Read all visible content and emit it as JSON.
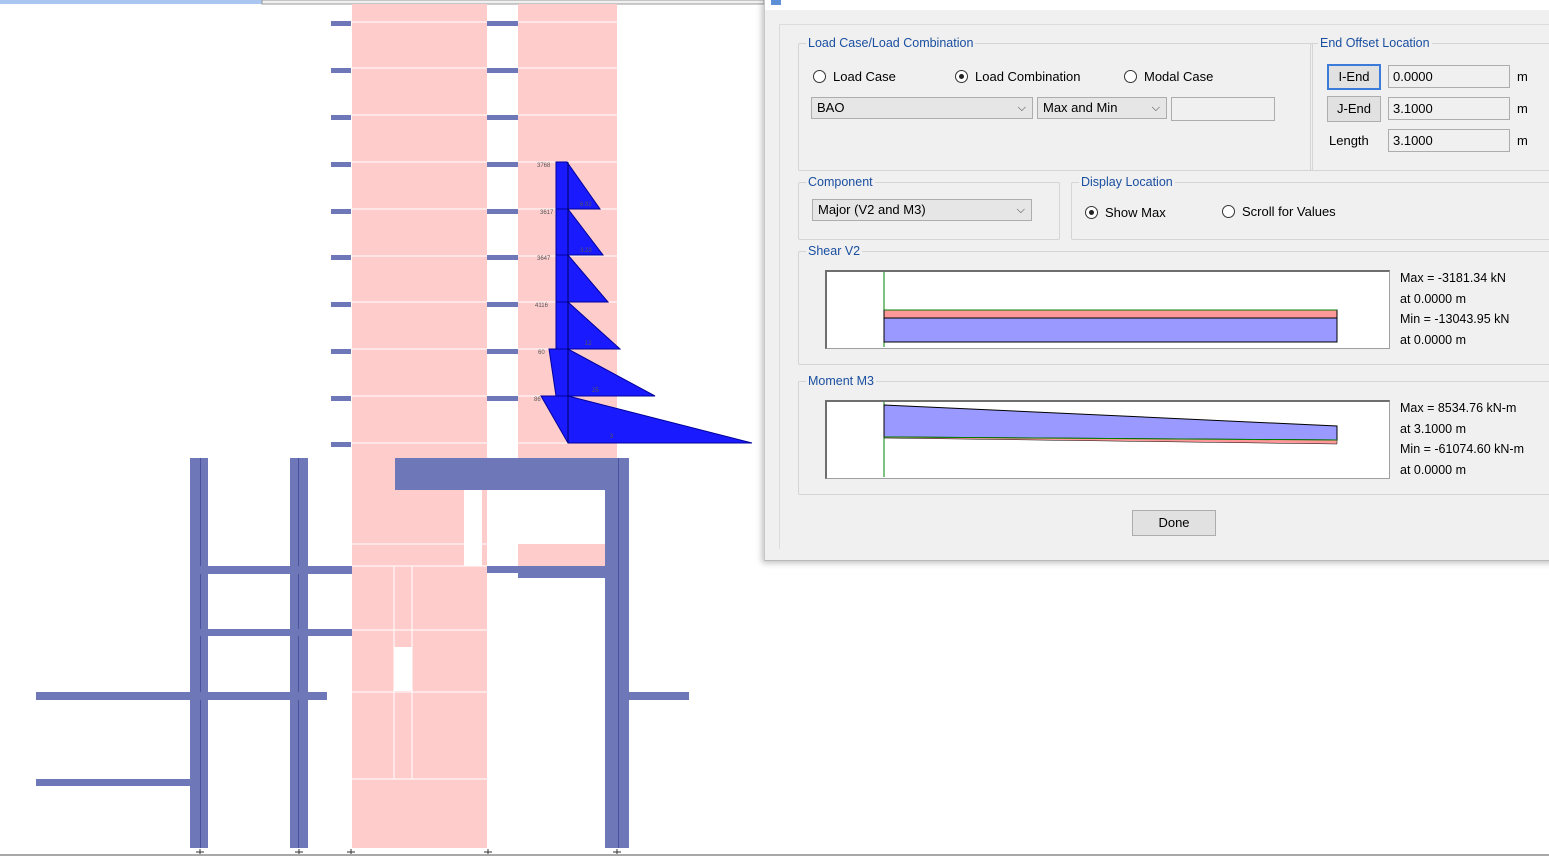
{
  "dialog": {
    "title": "",
    "load_case_group": {
      "legend": "Load Case/Load Combination",
      "options": [
        "Load Case",
        "Load Combination",
        "Modal Case"
      ],
      "selected_index": 1,
      "case_name": "BAO",
      "envelope": "Max and Min",
      "extra_field": ""
    },
    "end_offset": {
      "legend": "End Offset Location",
      "i_end_label": "I-End",
      "i_end_value": "0.0000",
      "j_end_label": "J-End",
      "j_end_value": "3.1000",
      "length_label": "Length",
      "length_value": "3.1000",
      "unit": "m"
    },
    "component": {
      "legend": "Component",
      "value": "Major (V2 and M3)"
    },
    "display_location": {
      "legend": "Display Location",
      "options": [
        "Show Max",
        "Scroll for Values"
      ],
      "selected_index": 0
    },
    "shear": {
      "legend": "Shear V2",
      "max": "Max = -3181.34 kN",
      "max_at": "at 0.0000 m",
      "min": "Min = -13043.95 kN",
      "min_at": "at 0.0000 m"
    },
    "moment": {
      "legend": "Moment M3",
      "max": "Max = 8534.76 kN-m",
      "max_at": "at 3.1000 m",
      "min": "Min = -61074.60 kN-m",
      "min_at": "at 0.0000 m"
    },
    "done_label": "Done"
  },
  "colors": {
    "wall": "#ffcccc",
    "frame": "#6e78b8",
    "diagram": "#1a1aff",
    "dialog_bg": "#f0f0f0",
    "group_title": "#1a4fa0",
    "shear_min_fill": "#9999ff",
    "shear_max_fill": "#ff9999"
  },
  "icons": [
    "radio-selected-icon",
    "radio-unselected-icon",
    "chevron-down-icon",
    "support-icon"
  ]
}
